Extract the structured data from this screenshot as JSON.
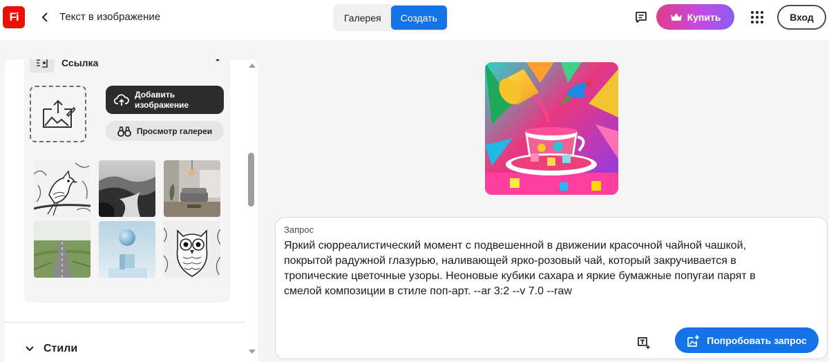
{
  "app": {
    "logo_text": "Fi",
    "page_title": "Текст в изображение"
  },
  "header": {
    "tabs": [
      {
        "label": "Галерея",
        "active": false
      },
      {
        "label": "Создать",
        "active": true
      }
    ],
    "buy_label": "Купить",
    "login_label": "Вход"
  },
  "reference": {
    "type_label": "Ссылка",
    "add_image_label": "Добавить изображение",
    "gallery_label": "Просмотр галереи",
    "thumbnails": [
      {
        "icon": "bird-sketch"
      },
      {
        "icon": "misty-river"
      },
      {
        "icon": "living-room"
      },
      {
        "icon": "straight-road"
      },
      {
        "icon": "ball-on-cube"
      },
      {
        "icon": "owl-sketch"
      }
    ]
  },
  "styles": {
    "label": "Стили"
  },
  "prompt": {
    "label": "Запрос",
    "text": "Яркий сюрреалистический момент с подвешенной в движении красочной чайной чашкой, покрытой радужной глазурью, наливающей ярко-розовый чай, который закручивается в тропические цветочные узоры. Неоновые кубики сахара и яркие бумажные попугаи парят в смелой композиции в стиле поп-арт. --ar 3:2 --v 7.0 --raw",
    "try_label": "Попробовать запрос"
  },
  "colors": {
    "accent": "#1473e6",
    "logo": "#eb1000",
    "buy_gradient_start": "#e23b8a",
    "buy_gradient_end": "#8b5cf6"
  }
}
